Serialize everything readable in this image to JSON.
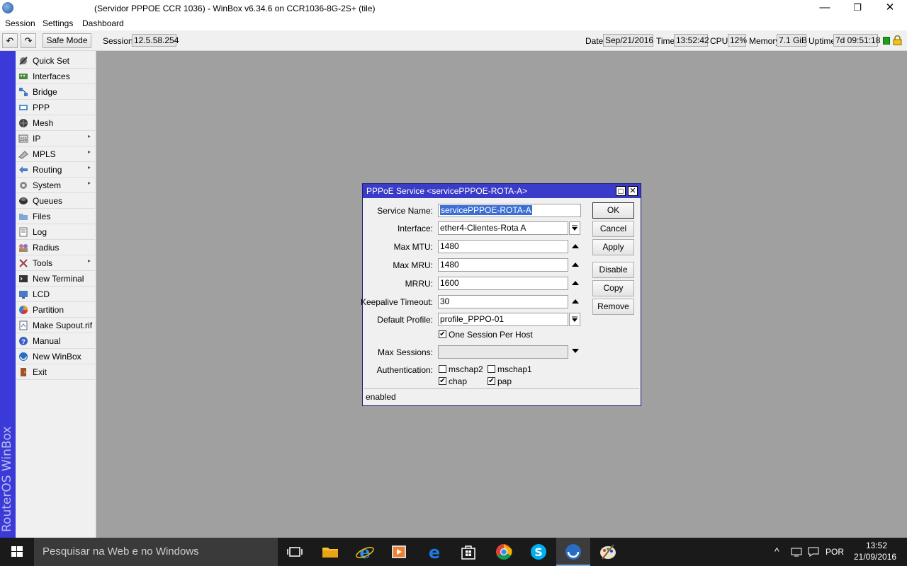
{
  "window": {
    "title": "(Servidor PPPOE CCR 1036) - WinBox v6.34.6 on CCR1036-8G-2S+ (tile)",
    "minimize_glyph": "—",
    "maximize_glyph": "❐",
    "close_glyph": "✕"
  },
  "menubar": {
    "items": [
      "Session",
      "Settings",
      "Dashboard"
    ]
  },
  "toolbar": {
    "undo_glyph": "↶",
    "redo_glyph": "↷",
    "safe_mode": "Safe Mode",
    "session_label": "Session:",
    "session_value": "12.5.58.254",
    "date_label": "Date:",
    "date_value": "Sep/21/2016",
    "time_label": "Time:",
    "time_value": "13:52:42",
    "cpu_label": "CPU:",
    "cpu_value": "12%",
    "memory_label": "Memory:",
    "memory_value": "7.1 GiB",
    "uptime_label": "Uptime:",
    "uptime_value": "7d 09:51:18"
  },
  "brand": "RouterOS WinBox",
  "sidebar": {
    "items": [
      {
        "label": "Quick Set",
        "icon": "quick-set-icon"
      },
      {
        "label": "Interfaces",
        "icon": "interfaces-icon"
      },
      {
        "label": "Bridge",
        "icon": "bridge-icon"
      },
      {
        "label": "PPP",
        "icon": "ppp-icon"
      },
      {
        "label": "Mesh",
        "icon": "mesh-icon"
      },
      {
        "label": "IP",
        "icon": "ip-icon",
        "submenu": true
      },
      {
        "label": "MPLS",
        "icon": "mpls-icon",
        "submenu": true
      },
      {
        "label": "Routing",
        "icon": "routing-icon",
        "submenu": true
      },
      {
        "label": "System",
        "icon": "system-icon",
        "submenu": true
      },
      {
        "label": "Queues",
        "icon": "queues-icon"
      },
      {
        "label": "Files",
        "icon": "files-icon"
      },
      {
        "label": "Log",
        "icon": "log-icon"
      },
      {
        "label": "Radius",
        "icon": "radius-icon"
      },
      {
        "label": "Tools",
        "icon": "tools-icon",
        "submenu": true
      },
      {
        "label": "New Terminal",
        "icon": "terminal-icon"
      },
      {
        "label": "LCD",
        "icon": "lcd-icon"
      },
      {
        "label": "Partition",
        "icon": "partition-icon"
      },
      {
        "label": "Make Supout.rif",
        "icon": "supout-icon"
      },
      {
        "label": "Manual",
        "icon": "manual-icon"
      },
      {
        "label": "New WinBox",
        "icon": "winbox-icon"
      },
      {
        "label": "Exit",
        "icon": "exit-icon"
      }
    ]
  },
  "dialog": {
    "title": "PPPoE Service <servicePPPOE-ROTA-A>",
    "restore_glyph": "□",
    "close_glyph": "✕",
    "fields": {
      "service_name_label": "Service Name:",
      "service_name_value": "servicePPPOE-ROTA-A",
      "interface_label": "Interface:",
      "interface_value": "ether4-Clientes-Rota A",
      "max_mtu_label": "Max MTU:",
      "max_mtu_value": "1480",
      "max_mru_label": "Max MRU:",
      "max_mru_value": "1480",
      "mrru_label": "MRRU:",
      "mrru_value": "1600",
      "keepalive_label": "Keepalive Timeout:",
      "keepalive_value": "30",
      "default_profile_label": "Default Profile:",
      "default_profile_value": "profile_PPPO-01",
      "one_session_label": "One Session Per Host",
      "one_session_checked": true,
      "max_sessions_label": "Max Sessions:",
      "max_sessions_value": "",
      "authentication_label": "Authentication:",
      "auth": [
        {
          "label": "mschap2",
          "checked": false
        },
        {
          "label": "mschap1",
          "checked": false
        },
        {
          "label": "chap",
          "checked": true
        },
        {
          "label": "pap",
          "checked": true
        }
      ]
    },
    "buttons": [
      "OK",
      "Cancel",
      "Apply",
      "Disable",
      "Copy",
      "Remove"
    ],
    "status": "enabled",
    "check_glyph": "✔"
  },
  "taskbar": {
    "search_placeholder": "Pesquisar na Web e no Windows",
    "language": "POR",
    "clock_time": "13:52",
    "clock_date": "21/09/2016",
    "apps": [
      "task-view-icon",
      "file-explorer-icon",
      "internet-explorer-icon",
      "media-player-icon",
      "edge-icon",
      "store-icon",
      "chrome-icon",
      "skype-icon",
      "winbox-icon",
      "paint-icon"
    ]
  },
  "colors": {
    "dialog_title_bg": "#3b3bc9",
    "brand_strip": "#3a3ad8",
    "desktop": "#a0a0a0",
    "selection": "#3b6fd4"
  }
}
